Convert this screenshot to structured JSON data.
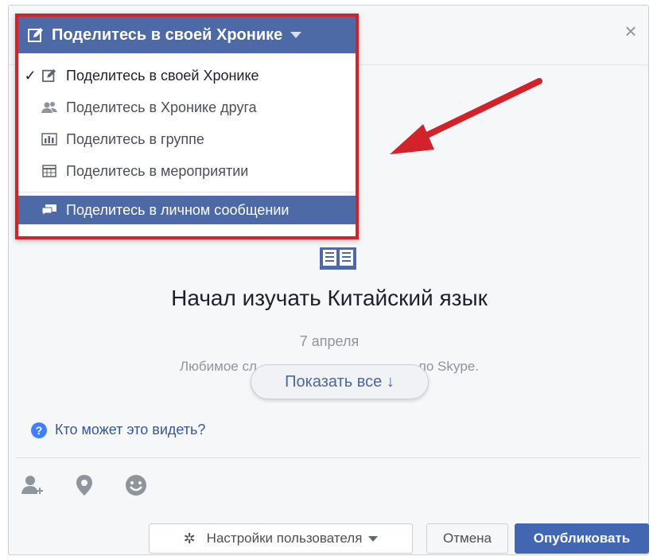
{
  "dropdown": {
    "header": "Поделитесь в своей Хронике",
    "items": [
      {
        "label": "Поделитесь в своей Хронике",
        "checked": "✓",
        "icon": "pencil-icon"
      },
      {
        "label": "Поделитесь в Хронике друга",
        "checked": "",
        "icon": "friends-icon"
      },
      {
        "label": "Поделитесь в группе",
        "checked": "",
        "icon": "group-icon"
      },
      {
        "label": "Поделитесь в мероприятии",
        "checked": "",
        "icon": "calendar-icon"
      }
    ],
    "active_item": {
      "label": "Поделитесь в личном сообщении",
      "icon": "message-icon"
    }
  },
  "close_symbol": "×",
  "event": {
    "title": "Начал изучать Китайский язык",
    "date": "7 апреля",
    "desc_left": "Любимое сл",
    "desc_right": "— по Skype."
  },
  "show_all": "Показать все ↓",
  "privacy": {
    "q_symbol": "?",
    "link": "Кто может это видеть?"
  },
  "tools": [
    "tag-friend-icon",
    "location-icon",
    "emoji-icon"
  ],
  "footer": {
    "settings_label": "Настройки пользователя",
    "settings_icon": "✲",
    "cancel_label": "Отмена",
    "publish_label": "Опубликовать"
  },
  "colors": {
    "header_blue": "#4d69a6",
    "highlight_red": "#d4222a",
    "publish_blue": "#4267b2",
    "link_blue": "#365899"
  }
}
